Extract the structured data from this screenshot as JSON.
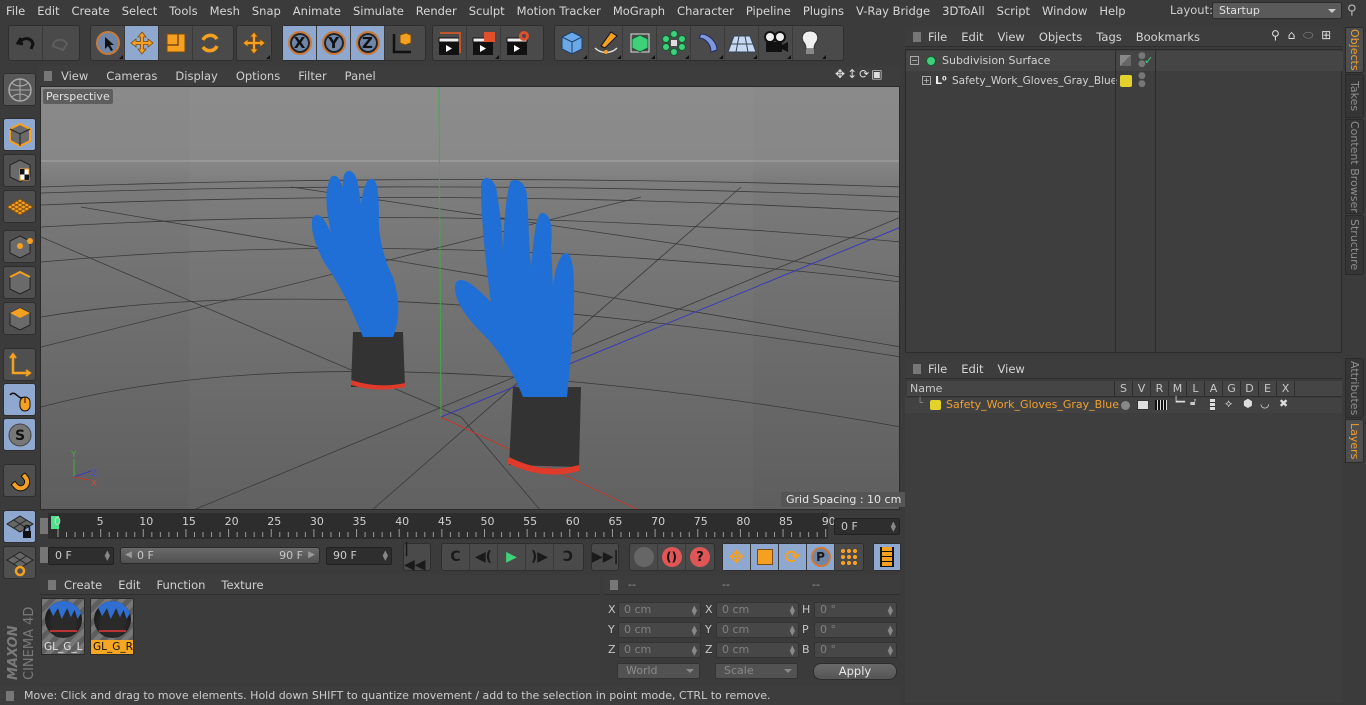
{
  "menubar": {
    "items": [
      "File",
      "Edit",
      "Create",
      "Select",
      "Tools",
      "Mesh",
      "Snap",
      "Animate",
      "Simulate",
      "Render",
      "Sculpt",
      "Motion Tracker",
      "MoGraph",
      "Character",
      "Pipeline",
      "Plugins",
      "V-Ray Bridge",
      "3DToAll",
      "Script",
      "Window",
      "Help"
    ],
    "layout_label": "Layout:",
    "layout_value": "Startup"
  },
  "toolbar": {
    "icons": [
      "undo-icon",
      "redo-icon",
      "live-selection-icon",
      "move-icon",
      "scale-icon",
      "rotate-icon",
      "last-tool-icon",
      "x-axis-icon",
      "y-axis-icon",
      "z-axis-icon",
      "coordinate-system-icon",
      "render-view-icon",
      "render-picture-viewer-icon",
      "render-settings-icon",
      "cube-icon",
      "pen-spline-icon",
      "subdivision-surface-icon",
      "cloner-icon",
      "deformer-icon",
      "floor-icon",
      "camera-icon",
      "light-icon"
    ],
    "axes": [
      "X",
      "Y",
      "Z"
    ]
  },
  "viewport": {
    "menu": [
      "View",
      "Cameras",
      "Display",
      "Options",
      "Filter",
      "Panel"
    ],
    "camera_label": "Perspective",
    "grid_spacing": "Grid Spacing : 10 cm",
    "axis_labels": [
      "Y",
      "Z",
      "X"
    ],
    "colors": {
      "glove_blue": "#1f6fd6",
      "cuff_gray": "#3a3a3a",
      "cuff_red": "#e03a2a",
      "y_axis": "#3fae3f",
      "x_axis": "#c0392b",
      "z_axis": "#3a3ab8"
    }
  },
  "timeline": {
    "ticks": [
      "0",
      "5",
      "10",
      "15",
      "20",
      "25",
      "30",
      "35",
      "40",
      "45",
      "50",
      "55",
      "60",
      "65",
      "70",
      "75",
      "80",
      "85",
      "90"
    ],
    "current_frame": "0 F",
    "start_field": "0 F",
    "range_start": "0 F",
    "range_end": "90 F",
    "end_field": "90 F",
    "playhead_color": "#4de38a"
  },
  "material_manager": {
    "menu": [
      "Create",
      "Edit",
      "Function",
      "Texture"
    ],
    "materials": [
      {
        "name": "GL_G_L",
        "selected": false
      },
      {
        "name": "GL_G_R",
        "selected": true
      }
    ],
    "logo_top": "MAXON",
    "logo_bottom": "CINEMA 4D"
  },
  "coordinates": {
    "headers": [
      "--",
      "--",
      "--"
    ],
    "position": [
      {
        "axis": "X",
        "value": "0 cm"
      },
      {
        "axis": "Y",
        "value": "0 cm"
      },
      {
        "axis": "Z",
        "value": "0 cm"
      }
    ],
    "size": [
      {
        "axis": "X",
        "value": "0 cm"
      },
      {
        "axis": "Y",
        "value": "0 cm"
      },
      {
        "axis": "Z",
        "value": "0 cm"
      }
    ],
    "rotation": [
      {
        "axis": "H",
        "value": "0 °"
      },
      {
        "axis": "P",
        "value": "0 °"
      },
      {
        "axis": "B",
        "value": "0 °"
      }
    ],
    "mode_select": "World",
    "size_select": "Scale",
    "apply_label": "Apply"
  },
  "status": {
    "text": "Move: Click and drag to move elements. Hold down SHIFT to quantize movement / add to the selection in point mode, CTRL to remove."
  },
  "object_manager": {
    "menu": [
      "File",
      "Edit",
      "View",
      "Objects",
      "Tags",
      "Bookmarks"
    ],
    "objects": [
      {
        "name": "Subdivision Surface",
        "icon": "subdivision-surface-icon",
        "expanded": true
      },
      {
        "name": "Safety_Work_Gloves_Gray_Blue",
        "icon": "null-object-icon",
        "expanded": false,
        "layer_color": "#e3d22c"
      }
    ]
  },
  "layer_manager": {
    "menu": [
      "File",
      "Edit",
      "View"
    ],
    "columns": [
      "Name",
      "S",
      "V",
      "R",
      "M",
      "L",
      "A",
      "G",
      "D",
      "E",
      "X"
    ],
    "layers": [
      {
        "name": "Safety_Work_Gloves_Gray_Blue",
        "color": "#e3d22c",
        "text_color": "#f0a030"
      }
    ]
  },
  "right_tabs": {
    "top": [
      {
        "label": "Objects",
        "active": true
      },
      {
        "label": "Takes",
        "active": false
      },
      {
        "label": "Content Browser",
        "active": false
      },
      {
        "label": "Structure",
        "active": false
      }
    ],
    "bottom": [
      {
        "label": "Attributes",
        "active": false
      },
      {
        "label": "Layers",
        "active": true
      }
    ]
  }
}
